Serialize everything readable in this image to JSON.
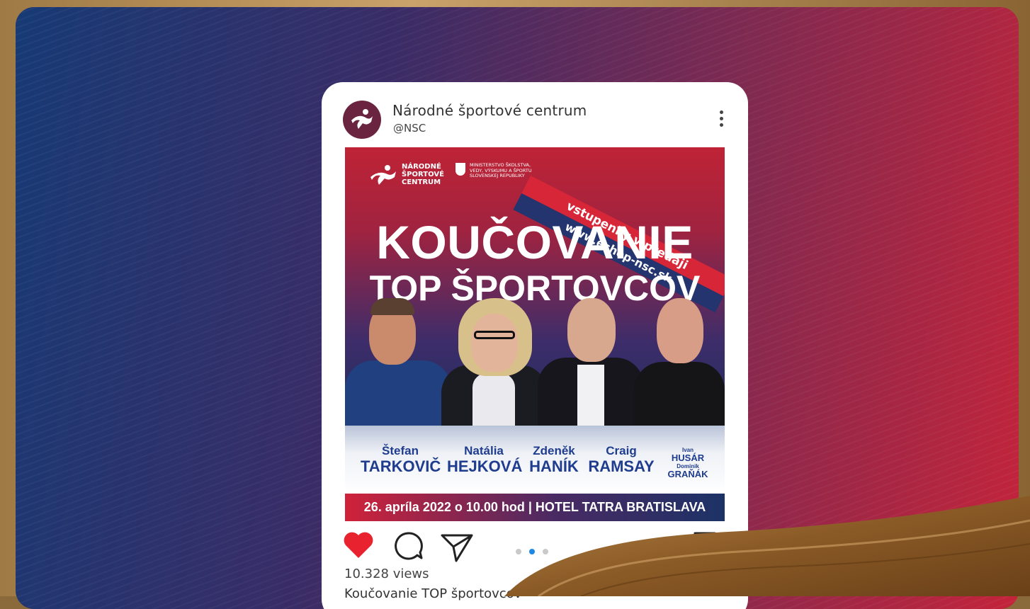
{
  "account": {
    "name": "Národné športové centrum",
    "handle": "@NSC"
  },
  "poster": {
    "org_logo_text": "NÁRODNÉ ŠPORTOVÉ CENTRUM",
    "ministry_text": "MINISTERSTVO ŠKOLSTVA, VEDY, VÝSKUMU A ŠPORTU SLOVENSKEJ REPUBLIKY",
    "ribbon_top": "vstupenky v predaji",
    "ribbon_bottom": "www.eshop-nsc.sk",
    "title_line1": "KOUČOVANIE",
    "title_line2": "TOP ŠPORTOVCOV",
    "speakers": [
      {
        "first": "Štefan",
        "last": "TARKOVIČ"
      },
      {
        "first": "Natália",
        "last": "HEJKOVÁ"
      },
      {
        "first": "Zdeněk",
        "last": "HANÍK"
      },
      {
        "first": "Craig",
        "last": "RAMSAY"
      }
    ],
    "extra_speakers": [
      {
        "first": "Ivan",
        "last": "HUSÁR"
      },
      {
        "first": "Dominik",
        "last": "GRAŇÁK"
      }
    ],
    "date_line": "26. apríla 2022 o 10.00 hod | HOTEL TATRA BRATISLAVA"
  },
  "post_meta": {
    "views": "10.328 views",
    "caption": "Koučovanie TOP športovcov"
  },
  "carousel": {
    "count": 3,
    "active_index": 1
  },
  "colors": {
    "like_red": "#e8232f",
    "active_dot": "#1e88e5",
    "brand_blue": "#1f3c8e",
    "brand_red": "#d72638"
  },
  "icons": [
    "more-vertical-icon",
    "heart-icon",
    "comment-icon",
    "send-icon",
    "bookmark-icon"
  ]
}
